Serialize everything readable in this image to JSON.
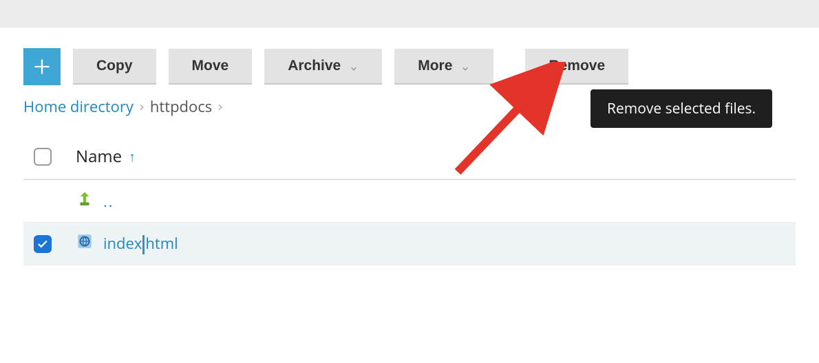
{
  "toolbar": {
    "copy_label": "Copy",
    "move_label": "Move",
    "archive_label": "Archive",
    "more_label": "More",
    "remove_label": "Remove"
  },
  "breadcrumb": {
    "home_label": "Home directory",
    "current": "httpdocs"
  },
  "columns": {
    "name_label": "Name",
    "sort_indicator": "↑"
  },
  "rows": {
    "up_label": "..",
    "file1_name_a": "index",
    "file1_name_b": "html"
  },
  "tooltip": {
    "remove_btn_tip": "Remove selected files."
  }
}
